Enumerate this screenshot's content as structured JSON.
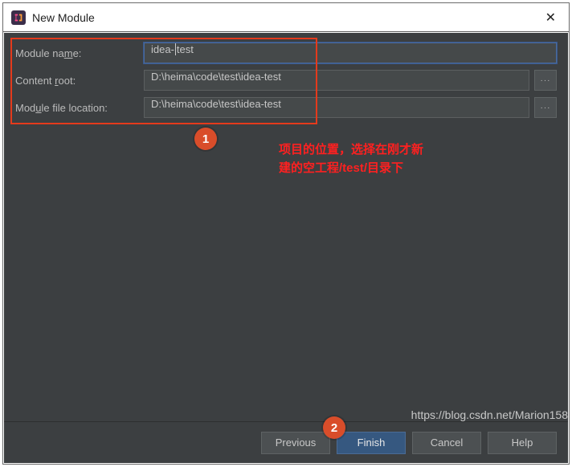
{
  "window": {
    "title": "New Module"
  },
  "fields": {
    "module_name": {
      "label_pre": "Module na",
      "label_u": "m",
      "label_post": "e:",
      "value_pre": "idea-",
      "value_post": "test"
    },
    "content_root": {
      "label_pre": "Content ",
      "label_u": "r",
      "label_post": "oot:",
      "value": "D:\\heima\\code\\test\\idea-test"
    },
    "module_file_location": {
      "label_pre": "Mod",
      "label_u": "u",
      "label_post": "le file location:",
      "value": "D:\\heima\\code\\test\\idea-test"
    }
  },
  "browse_glyph": "···",
  "badges": {
    "one": "1",
    "two": "2"
  },
  "annotation": {
    "line1": "项目的位置，选择在刚才新",
    "line2": "建的空工程/test/目录下"
  },
  "buttons": {
    "previous": "Previous",
    "finish": "Finish",
    "cancel": "Cancel",
    "help": "Help"
  },
  "watermark": "https://blog.csdn.net/Marion158"
}
